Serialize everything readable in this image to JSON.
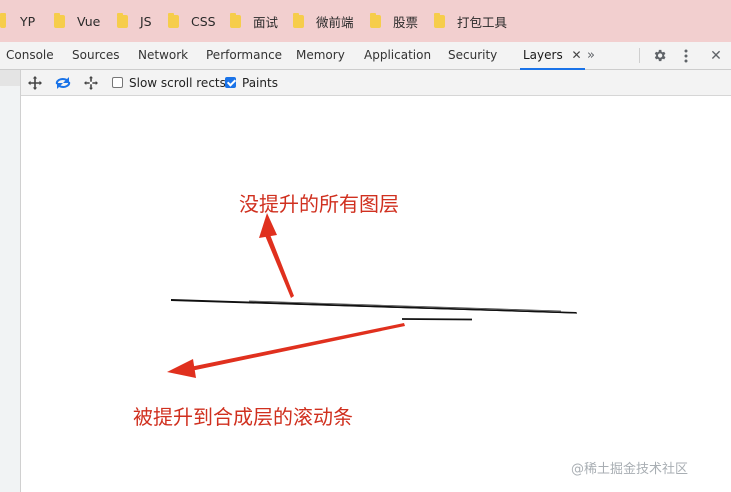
{
  "bookmarks": [
    {
      "label": "YP"
    },
    {
      "label": "Vue"
    },
    {
      "label": "JS"
    },
    {
      "label": "CSS"
    },
    {
      "label": "面试"
    },
    {
      "label": "微前端"
    },
    {
      "label": "股票"
    },
    {
      "label": "打包工具"
    }
  ],
  "tabs": [
    {
      "label": "Console"
    },
    {
      "label": "Sources"
    },
    {
      "label": "Network"
    },
    {
      "label": "Performance"
    },
    {
      "label": "Memory"
    },
    {
      "label": "Application"
    },
    {
      "label": "Security"
    },
    {
      "label": "Layers",
      "active": true
    }
  ],
  "layers_toolbar": {
    "slow_scroll_rects": {
      "label": "Slow scroll rects",
      "checked": false
    },
    "paints": {
      "label": "Paints",
      "checked": true
    }
  },
  "annotations": {
    "top": "没提升的所有图层",
    "bottom": "被提升到合成层的滚动条"
  },
  "watermark": "@稀土掘金技术社区",
  "colors": {
    "bookmark_bar": "#f2cfcf",
    "annotation": "#d0301f",
    "accent": "#1a73e8"
  }
}
